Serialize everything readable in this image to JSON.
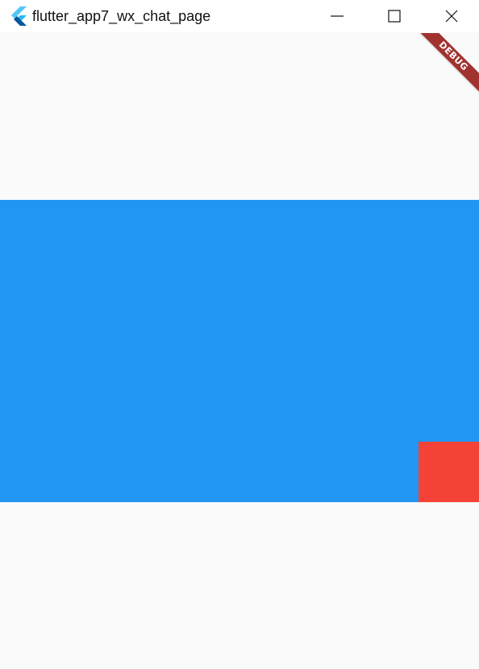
{
  "window": {
    "title": "flutter_app7_wx_chat_page",
    "icon": "flutter-logo-icon",
    "controls": {
      "minimize_icon": "minimize-icon",
      "maximize_icon": "maximize-icon",
      "close_icon": "close-icon"
    }
  },
  "app": {
    "debug_banner_label": "DEBUG",
    "colors": {
      "background": "#fafafa",
      "blue_container": "#2196f3",
      "red_container": "#f44336",
      "debug_banner": "#a0332f"
    }
  }
}
